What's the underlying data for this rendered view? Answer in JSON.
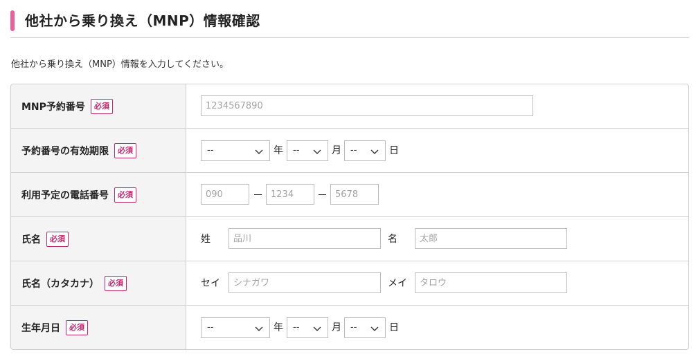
{
  "header": {
    "title": "他社から乗り換え（MNP）情報確認"
  },
  "intro": "他社から乗り換え（MNP）情報を入力してください。",
  "required_label": "必須",
  "rows": {
    "mnp_number": {
      "label": "MNP予約番号",
      "placeholder": "1234567890"
    },
    "expiry": {
      "label": "予約番号の有効期限",
      "year_value": "--",
      "year_unit": "年",
      "month_value": "--",
      "month_unit": "月",
      "day_value": "--",
      "day_unit": "日"
    },
    "phone": {
      "label": "利用予定の電話番号",
      "part1_placeholder": "090",
      "part2_placeholder": "1234",
      "part3_placeholder": "5678"
    },
    "name": {
      "label": "氏名",
      "last_label": "姓",
      "last_placeholder": "品川",
      "first_label": "名",
      "first_placeholder": "太郎"
    },
    "name_kana": {
      "label": "氏名（カタカナ）",
      "last_label": "セイ",
      "last_placeholder": "シナガワ",
      "first_label": "メイ",
      "first_placeholder": "タロウ"
    },
    "birthdate": {
      "label": "生年月日",
      "year_value": "--",
      "year_unit": "年",
      "month_value": "--",
      "month_unit": "月",
      "day_value": "--",
      "day_unit": "日"
    }
  },
  "icons": {
    "select_arrow": "chevron-down-icon"
  },
  "colors": {
    "accent": "#ec5f9b",
    "required": "#c6266f",
    "label_bg": "#f4f4f4",
    "border": "#cfcfcf"
  }
}
